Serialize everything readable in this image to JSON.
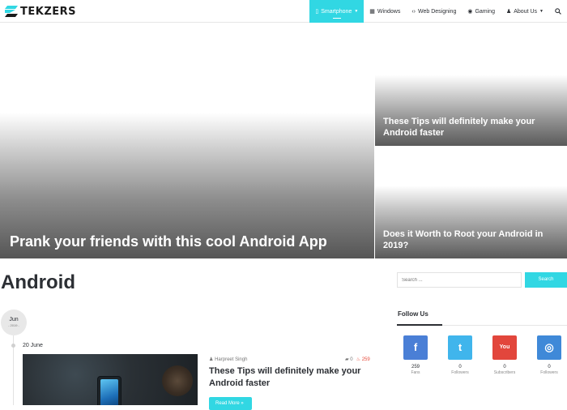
{
  "brand": {
    "name": "TEKZERS",
    "accent": "#31d7e3"
  },
  "nav": {
    "items": [
      {
        "label": "Smartphone",
        "icon": "mobile-icon",
        "active": true,
        "dropdown": true
      },
      {
        "label": "Windows",
        "icon": "windows-icon",
        "active": false,
        "dropdown": false
      },
      {
        "label": "Web Designing",
        "icon": "code-icon",
        "active": false,
        "dropdown": false
      },
      {
        "label": "Gaming",
        "icon": "gamepad-icon",
        "active": false,
        "dropdown": false
      },
      {
        "label": "About Us",
        "icon": "users-icon",
        "active": false,
        "dropdown": true
      }
    ],
    "search_icon": "search-icon"
  },
  "featured": {
    "main_title": "Prank your friends with this cool Android App",
    "side_1_title": "These Tips will definitely make your Android faster",
    "side_2_title": "Does it Worth to Root your Android in 2019?"
  },
  "page": {
    "title": "Android"
  },
  "timeline": {
    "month": "Jun",
    "year": "- 2019 -"
  },
  "post": {
    "date": "20 June",
    "author": "Harpreet Singh",
    "comments": "0",
    "views": "259",
    "title": "These Tips will definitely make your Android faster",
    "read_more": "Read More »"
  },
  "sidebar": {
    "search_placeholder": "Search ...",
    "search_button": "Search",
    "follow_title": "Follow Us",
    "social": [
      {
        "network": "facebook",
        "glyph": "f",
        "color": "#4a7fd6",
        "count": "259",
        "label": "Fans"
      },
      {
        "network": "twitter",
        "glyph": "t",
        "color": "#40b5ec",
        "count": "0",
        "label": "Followers"
      },
      {
        "network": "youtube",
        "glyph": "You",
        "color": "#e2463c",
        "count": "0",
        "label": "Subscribers"
      },
      {
        "network": "instagram",
        "glyph": "◎",
        "color": "#3f89d8",
        "count": "0",
        "label": "Followers"
      }
    ]
  }
}
